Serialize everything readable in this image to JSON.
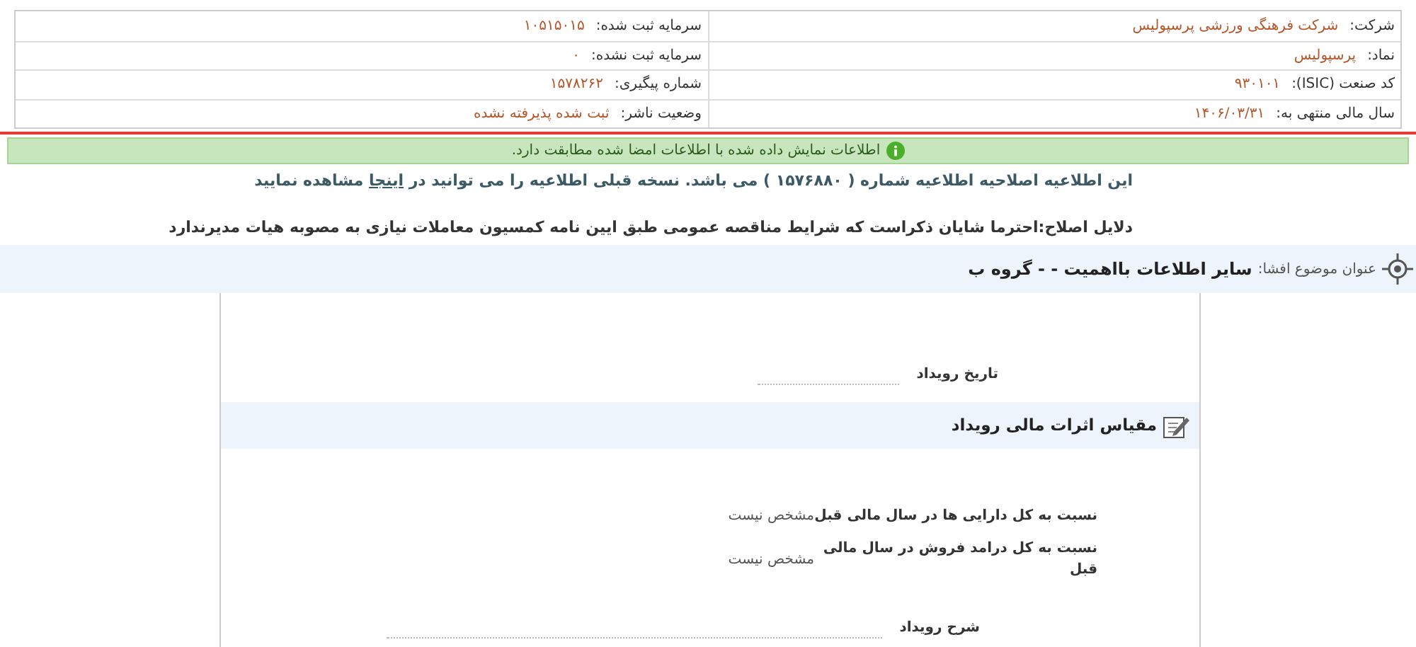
{
  "info_rows": [
    {
      "cells": [
        {
          "label": "شرکت:",
          "value": "شرکت فرهنگی ورزشی پرسپولیس"
        },
        {
          "label": "سرمایه ثبت شده:",
          "value": "۱۰۵۱۵۰۱۵"
        }
      ]
    },
    {
      "cells": [
        {
          "label": "نماد:",
          "value": "پرسپولیس"
        },
        {
          "label": "سرمایه ثبت نشده:",
          "value": "۰"
        }
      ]
    },
    {
      "cells": [
        {
          "label": "کد صنعت (ISIC):",
          "value": "۹۳۰۱۰۱"
        },
        {
          "label": "شماره پیگیری:",
          "value": "۱۵۷۸۲۶۲"
        }
      ]
    },
    {
      "cells": [
        {
          "label": "سال مالی منتهی به:",
          "value": "۱۴۰۶/۰۳/۳۱"
        },
        {
          "label": "وضعیت ناشر:",
          "value": "ثبت شده پذیرفته نشده"
        }
      ]
    }
  ],
  "verified_banner": "اطلاعات نمایش داده شده با اطلاعات امضا شده مطابقت دارد.",
  "correction_notice": {
    "before": "این اطلاعیه اصلاحیه اطلاعیه شماره ( ۱۵۷۶۸۸۰ ) می باشد. نسخه قبلی اطلاعیه را می توانید در",
    "link": "اینجا",
    "after": "مشاهده نمایید"
  },
  "correction_reasons": "دلایل اصلاح:احترما شایان ذکراست که شرایط مناقصه عمومی طبق ایین نامه کمسیون معاملات نیازی به مصوبه هیات مدیرندارد",
  "topic": {
    "label": "عنوان موضوع افشا:",
    "value": "سایر اطلاعات بااهمیت - - گروه ب"
  },
  "event_date": {
    "label": "تاریخ رویداد"
  },
  "financial_section": {
    "title": "مقیاس اثرات مالی رویداد",
    "rows": [
      {
        "label": "نسبت به کل دارایی ها در سال مالی قبل",
        "value": "مشخص نیست"
      },
      {
        "label": "نسبت به کل درامد فروش در سال مالی قبل",
        "value": "مشخص نیست"
      }
    ]
  },
  "event_description": {
    "label": "شرح رویداد"
  }
}
